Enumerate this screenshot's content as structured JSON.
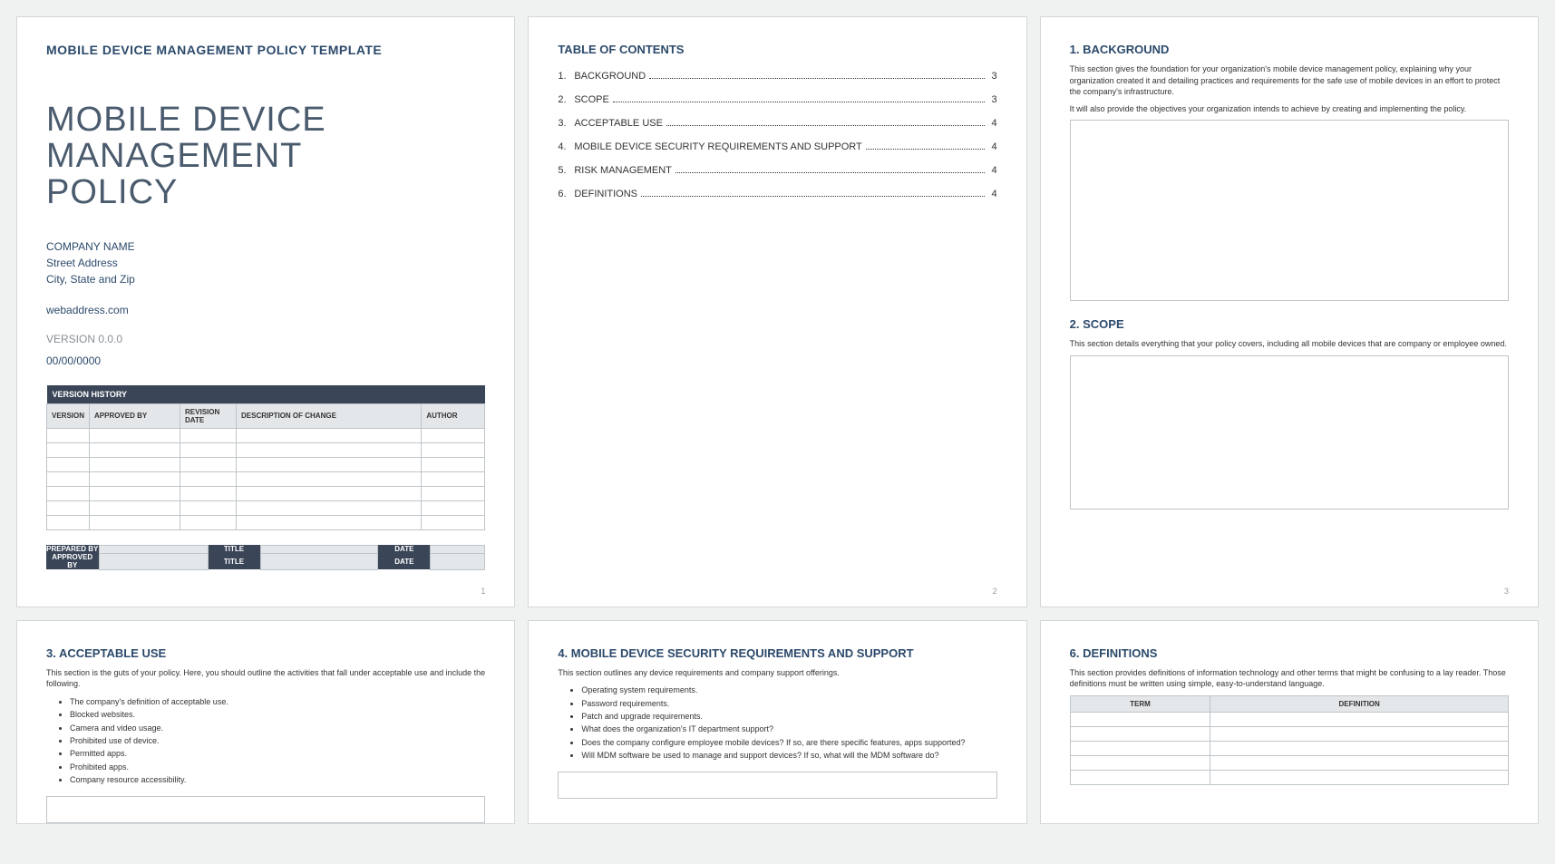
{
  "page1": {
    "template_label": "MOBILE DEVICE MANAGEMENT POLICY TEMPLATE",
    "title_l1": "MOBILE DEVICE",
    "title_l2": "MANAGEMENT",
    "title_l3": "POLICY",
    "company": "COMPANY NAME",
    "street": "Street Address",
    "city": "City, State and Zip",
    "web": "webaddress.com",
    "version": "VERSION 0.0.0",
    "date": "00/00/0000",
    "vh_title": "VERSION HISTORY",
    "vh_cols": {
      "version": "VERSION",
      "approved": "APPROVED BY",
      "revdate": "REVISION DATE",
      "desc": "DESCRIPTION OF CHANGE",
      "author": "AUTHOR"
    },
    "sig": {
      "prepared": "PREPARED BY",
      "approved": "APPROVED BY",
      "title": "TITLE",
      "date": "DATE"
    },
    "pnum": "1"
  },
  "page2": {
    "heading": "TABLE OF CONTENTS",
    "items": [
      {
        "n": "1.",
        "label": "BACKGROUND",
        "p": "3"
      },
      {
        "n": "2.",
        "label": "SCOPE",
        "p": "3"
      },
      {
        "n": "3.",
        "label": "ACCEPTABLE USE",
        "p": "4"
      },
      {
        "n": "4.",
        "label": "MOBILE DEVICE SECURITY REQUIREMENTS AND SUPPORT",
        "p": "4"
      },
      {
        "n": "5.",
        "label": "RISK MANAGEMENT",
        "p": "4"
      },
      {
        "n": "6.",
        "label": "DEFINITIONS",
        "p": "4"
      }
    ],
    "pnum": "2"
  },
  "page3": {
    "s1_h": "1.  BACKGROUND",
    "s1_p1": "This section gives the foundation for your organization's mobile device management policy, explaining why your organization created it and detailing practices and requirements for the safe use of mobile devices in an effort to protect the company's infrastructure.",
    "s1_p2": "It will also provide the objectives your organization intends to achieve by creating and implementing the policy.",
    "s2_h": "2.  SCOPE",
    "s2_p1": "This section details everything that your policy covers, including all mobile devices that are company or employee owned.",
    "pnum": "3"
  },
  "page4": {
    "h": "3.  ACCEPTABLE USE",
    "p1": "This section is the guts of your policy. Here, you should outline the activities that fall under acceptable use and include the following.",
    "bullets": [
      "The company's definition of acceptable use.",
      "Blocked websites.",
      "Camera and video usage.",
      "Prohibited use of device.",
      "Permitted apps.",
      "Prohibited apps.",
      "Company resource accessibility."
    ]
  },
  "page5": {
    "h": "4.  MOBILE DEVICE SECURITY REQUIREMENTS AND SUPPORT",
    "p1": "This section outlines any device requirements and company support offerings.",
    "bullets": [
      "Operating system requirements.",
      "Password requirements.",
      "Patch and upgrade requirements.",
      "What does the organization's IT department support?",
      "Does the company configure employee mobile devices? If so, are there specific features, apps supported?",
      "Will MDM software be used to manage and support devices? If so, what will the MDM software do?"
    ]
  },
  "page6": {
    "h": "6.  DEFINITIONS",
    "p1": "This section provides definitions of information technology and other terms that might be confusing to a lay reader. Those definitions must be written using simple, easy-to-understand language.",
    "cols": {
      "term": "TERM",
      "def": "DEFINITION"
    }
  }
}
